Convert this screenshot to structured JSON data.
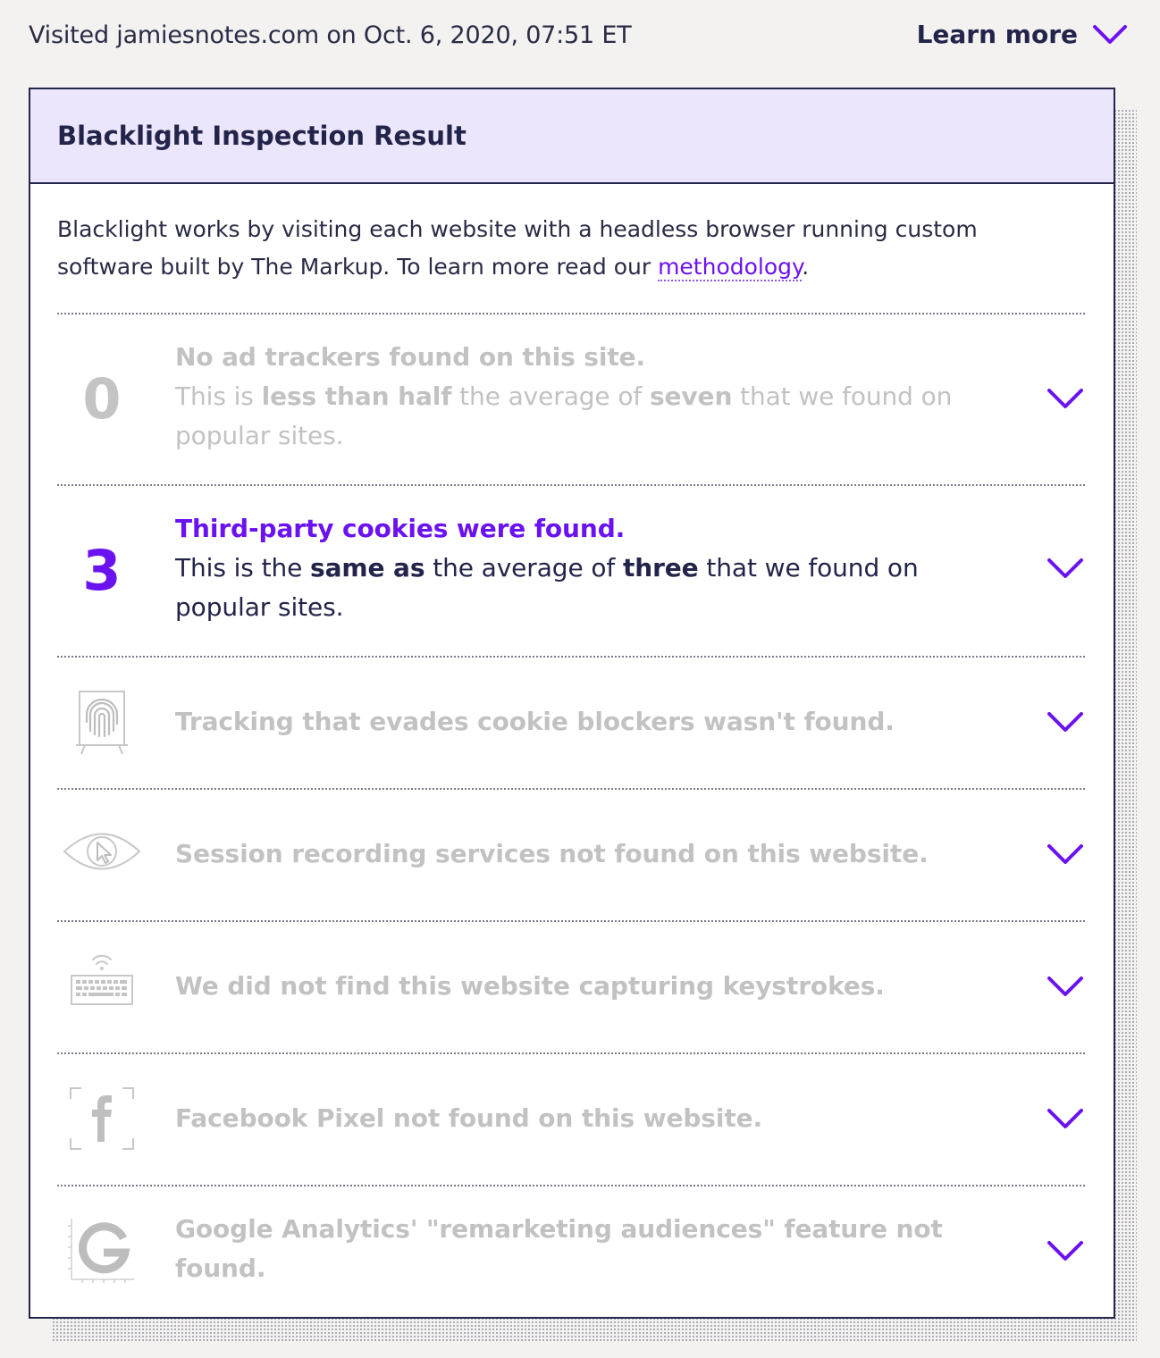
{
  "top": {
    "visited_text": "Visited jamiesnotes.com on Oct. 6, 2020, 07:51 ET",
    "learn_more": "Learn more"
  },
  "card": {
    "title": "Blacklight Inspection Result",
    "intro_text": "Blacklight works by visiting each website with a headless browser running custom software built by The Markup. To learn more read our ",
    "intro_link": "methodology",
    "intro_end": "."
  },
  "rows": [
    {
      "count": "0",
      "headline": "No ad trackers found on this site.",
      "d1": "This is ",
      "b1": "less than half",
      "d2": " the average of ",
      "b2": "seven",
      "d3": " that we found on popular sites."
    },
    {
      "count": "3",
      "headline": "Third-party cookies were found.",
      "d1": "This is the ",
      "b1": "same as",
      "d2": " the average of ",
      "b2": "three",
      "d3": " that we found on popular sites."
    },
    {
      "icon": "fingerprint-icon",
      "headline": "Tracking that evades cookie blockers wasn't found."
    },
    {
      "icon": "eye-cursor-icon",
      "headline": "Session recording services not found on this website."
    },
    {
      "icon": "keyboard-wifi-icon",
      "headline": "We did not find this website capturing keystrokes."
    },
    {
      "icon": "facebook-icon",
      "headline": "Facebook Pixel not found on this website."
    },
    {
      "icon": "google-icon",
      "headline": "Google Analytics' \"remarketing audiences\" feature not found."
    }
  ],
  "colors": {
    "accent": "#6b12f0",
    "dim_text": "#c2c2c2",
    "header_bg": "#ece6fc",
    "border": "#24254a",
    "page_bg": "#f3f2f1"
  }
}
